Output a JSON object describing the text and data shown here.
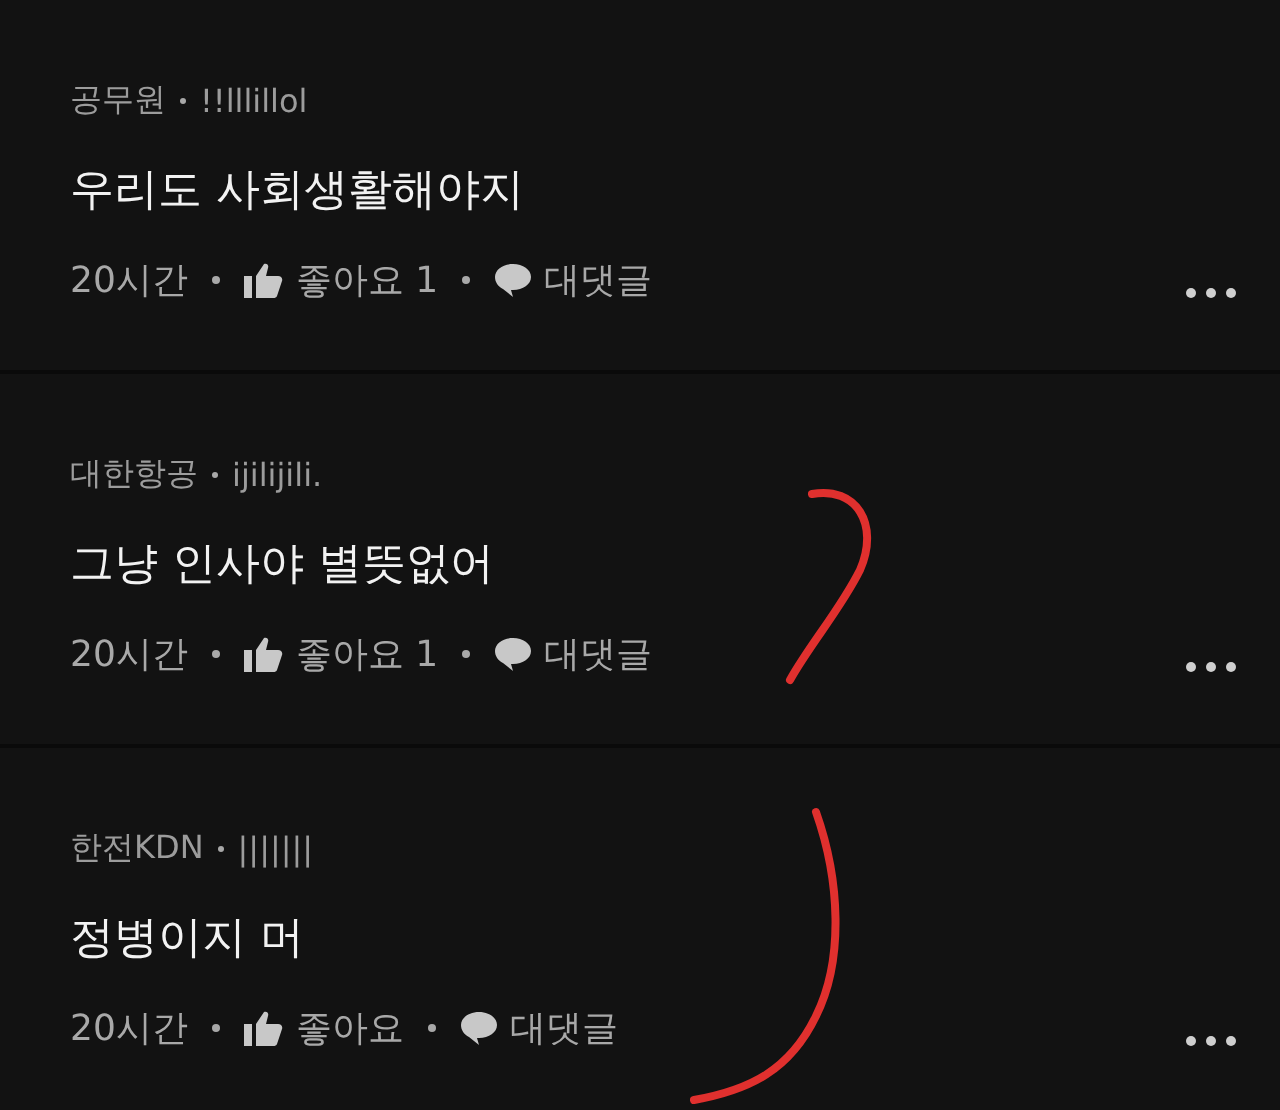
{
  "comments": [
    {
      "affiliation": "공무원",
      "author": "!!lllillol",
      "text": "우리도 사회생활해야지",
      "time": "20시간",
      "like_label": "좋아요",
      "like_count": "1",
      "reply_label": "대댓글"
    },
    {
      "affiliation": "대한항공",
      "author": "ijilijili.",
      "text": "그냥 인사야 별뜻없어",
      "time": "20시간",
      "like_label": "좋아요",
      "like_count": "1",
      "reply_label": "대댓글"
    },
    {
      "affiliation": "한전KDN",
      "author": "|||||||",
      "text": "정병이지 머",
      "time": "20시간",
      "like_label": "좋아요",
      "reply_label": "대댓글"
    }
  ]
}
